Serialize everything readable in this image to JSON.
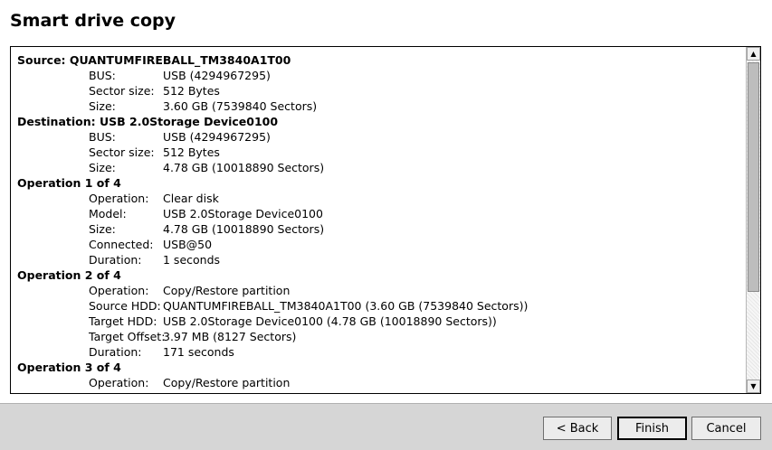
{
  "window": {
    "title": "Smart drive copy"
  },
  "report": {
    "source": {
      "heading": "Source: QUANTUMFIREBALL_TM3840A1T00",
      "rows": [
        {
          "label": "BUS:",
          "value": "USB (4294967295)"
        },
        {
          "label": "Sector size:",
          "value": "512 Bytes"
        },
        {
          "label": "Size:",
          "value": "3.60 GB (7539840 Sectors)"
        }
      ]
    },
    "destination": {
      "heading": "Destination: USB 2.0Storage Device0100",
      "rows": [
        {
          "label": "BUS:",
          "value": "USB (4294967295)"
        },
        {
          "label": "Sector size:",
          "value": "512 Bytes"
        },
        {
          "label": "Size:",
          "value": "4.78 GB (10018890 Sectors)"
        }
      ]
    },
    "op1": {
      "heading": "Operation 1 of 4",
      "rows": [
        {
          "label": "Operation:",
          "value": "Clear disk"
        },
        {
          "label": "Model:",
          "value": "USB 2.0Storage Device0100"
        },
        {
          "label": "Size:",
          "value": "4.78 GB (10018890 Sectors)"
        },
        {
          "label": "Connected:",
          "value": "USB@50"
        },
        {
          "label": "Duration:",
          "value": "1 seconds"
        }
      ]
    },
    "op2": {
      "heading": "Operation 2 of 4",
      "rows": [
        {
          "label": "Operation:",
          "value": "Copy/Restore partition"
        },
        {
          "label": "Source HDD:",
          "value": "QUANTUMFIREBALL_TM3840A1T00 (3.60 GB (7539840 Sectors))"
        },
        {
          "label": "Target HDD:",
          "value": "USB 2.0Storage Device0100 (4.78 GB (10018890 Sectors))"
        },
        {
          "label": "Target Offset:",
          "value": "3.97 MB (8127 Sectors)"
        },
        {
          "label": "Duration:",
          "value": "171 seconds"
        }
      ]
    },
    "op3": {
      "heading": "Operation 3 of 4",
      "rows": [
        {
          "label": "Operation:",
          "value": "Copy/Restore partition"
        }
      ]
    }
  },
  "scrollbar": {
    "up_glyph": "▲",
    "down_glyph": "▼"
  },
  "buttons": {
    "back": "< Back",
    "finish": "Finish",
    "cancel": "Cancel"
  }
}
